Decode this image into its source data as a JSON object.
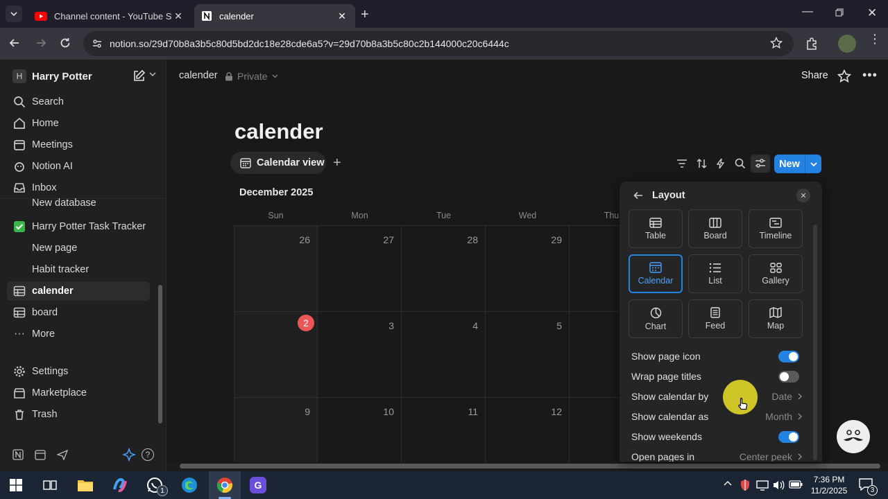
{
  "browser": {
    "tabs": [
      {
        "label": "Channel content - YouTube Stu",
        "icon": "youtube-icon"
      },
      {
        "label": "calender",
        "icon": "notion-icon"
      }
    ],
    "url": "notion.so/29d70b8a3b5c80d5bd2dc18e28cde6a5?v=29d70b8a3b5c80c2b144000c20c6444c"
  },
  "sidebar": {
    "workspace_initial": "H",
    "workspace_name": "Harry Potter",
    "items": [
      {
        "label": "Search",
        "icon": "search-icon"
      },
      {
        "label": "Home",
        "icon": "home-icon"
      },
      {
        "label": "Meetings",
        "icon": "meetings-icon"
      },
      {
        "label": "Notion AI",
        "icon": "notion-ai-icon"
      },
      {
        "label": "Inbox",
        "icon": "inbox-icon"
      }
    ],
    "pages": [
      {
        "label": "New database"
      },
      {
        "label": "Harry Potter Task Tracker",
        "icon": "checkbox-icon"
      },
      {
        "label": "New page",
        "icon": "page-icon"
      },
      {
        "label": "Habit tracker"
      },
      {
        "label": "calender",
        "icon": "table-icon"
      },
      {
        "label": "board",
        "icon": "table-icon"
      },
      {
        "label": "More",
        "icon": "more-icon"
      }
    ],
    "bottom": [
      {
        "label": "Settings",
        "icon": "gear-icon"
      },
      {
        "label": "Marketplace",
        "icon": "marketplace-icon"
      },
      {
        "label": "Trash",
        "icon": "trash-icon"
      }
    ]
  },
  "topbar": {
    "breadcrumb": "calender",
    "privacy": "Private",
    "share": "Share"
  },
  "page": {
    "title": "calender",
    "view_tab": "Calendar view",
    "new_button": "New",
    "month": "December 2025",
    "weekdays": [
      "Sun",
      "Mon",
      "Tue",
      "Wed",
      "Thu"
    ],
    "weeks": [
      [
        "26",
        "27",
        "28",
        "29"
      ],
      [
        "2",
        "3",
        "4",
        "5"
      ],
      [
        "9",
        "10",
        "11",
        "12"
      ]
    ],
    "today": "2",
    "colors": {
      "accent": "#2383e2",
      "today": "#eb5757"
    }
  },
  "panel": {
    "back_label": "Layout",
    "layouts": [
      {
        "label": "Table",
        "icon": "table-layout-icon"
      },
      {
        "label": "Board",
        "icon": "board-layout-icon"
      },
      {
        "label": "Timeline",
        "icon": "timeline-layout-icon"
      },
      {
        "label": "Calendar",
        "icon": "calendar-layout-icon"
      },
      {
        "label": "List",
        "icon": "list-layout-icon"
      },
      {
        "label": "Gallery",
        "icon": "gallery-layout-icon"
      },
      {
        "label": "Chart",
        "icon": "chart-layout-icon"
      },
      {
        "label": "Feed",
        "icon": "feed-layout-icon"
      },
      {
        "label": "Map",
        "icon": "map-layout-icon"
      }
    ],
    "selected": "Calendar",
    "options": {
      "show_page_icon": "Show page icon",
      "wrap_page_titles": "Wrap page titles",
      "show_calendar_by": "Show calendar by",
      "show_calendar_by_value": "Date",
      "show_calendar_as": "Show calendar as",
      "show_calendar_as_value": "Month",
      "show_weekends": "Show weekends",
      "open_pages_in": "Open pages in",
      "open_pages_in_value": "Center peek"
    }
  },
  "taskbar": {
    "time": "7:36 PM",
    "date": "11/2/2025",
    "whatsapp_badge": "1",
    "notification_badge": "3"
  }
}
